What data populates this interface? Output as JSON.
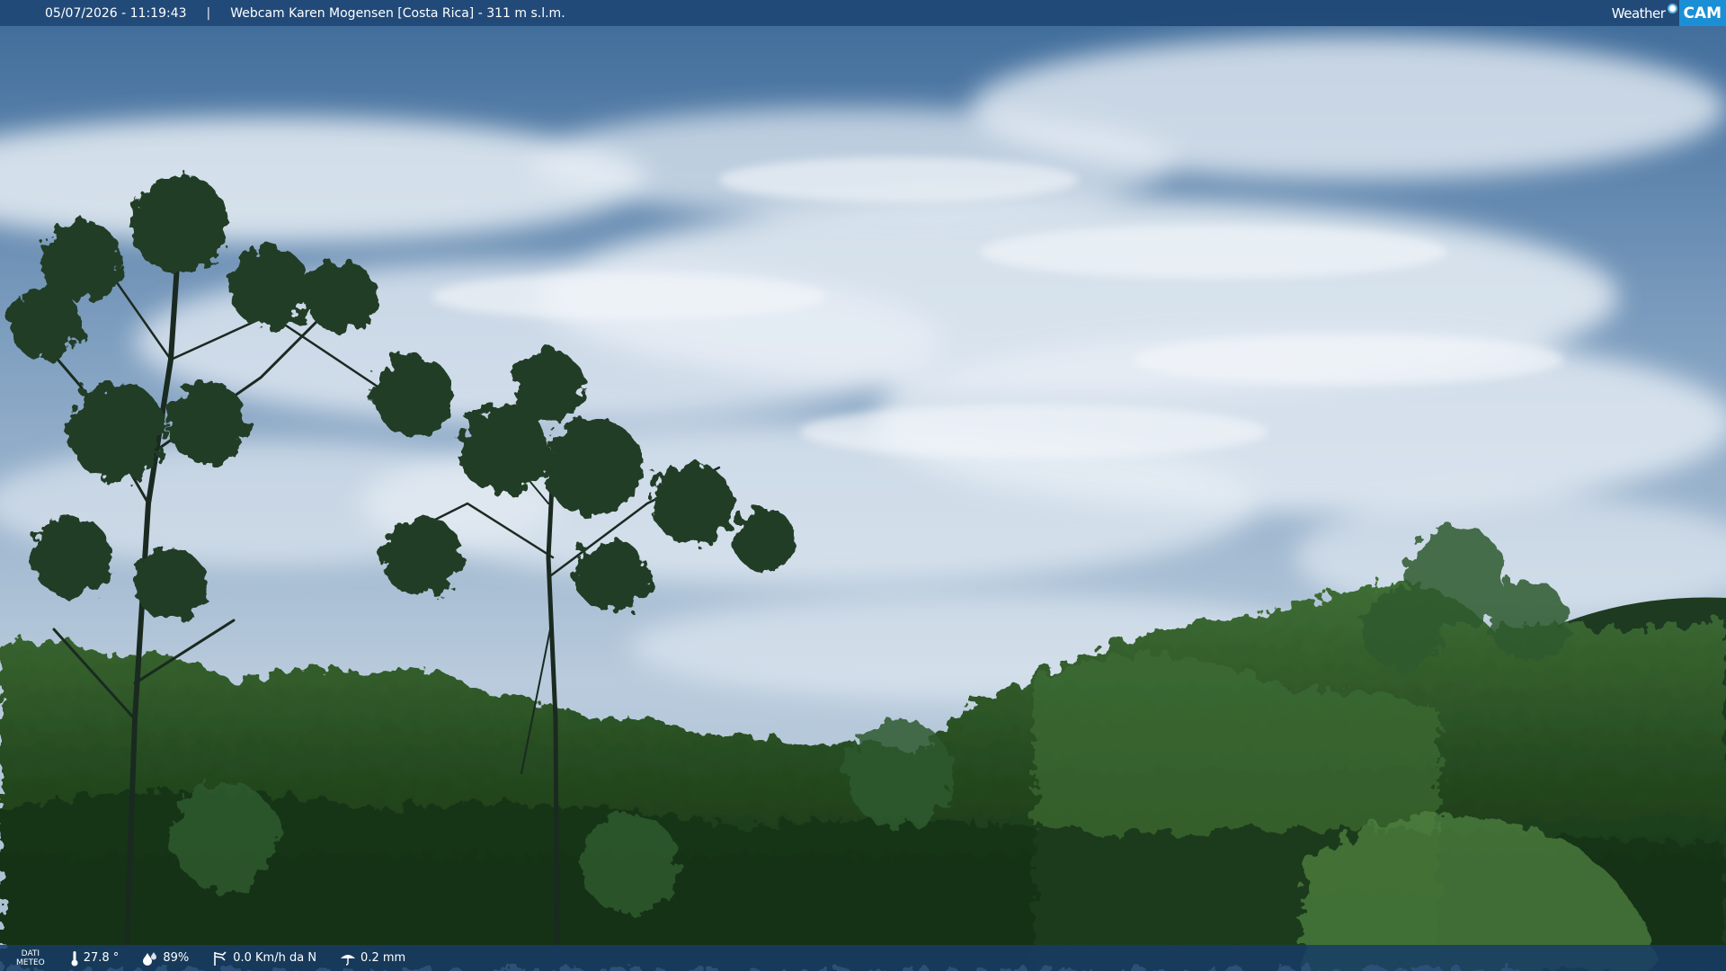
{
  "header": {
    "datetime": "05/07/2026 - 11:19:43",
    "separator": "|",
    "title": "Webcam Karen Mogensen [Costa Rica] - 311 m s.l.m."
  },
  "logo": {
    "word": "Weather",
    "cam": "CAM",
    "accent_color": "#1b8fd6"
  },
  "weather_bar": {
    "label_line1": "DATI",
    "label_line2": "METEO",
    "temperature": "27.8 °",
    "humidity": "89%",
    "wind": "0.0 Km/h da N",
    "rain": "0.2 mm",
    "icons": [
      "thermometer-icon",
      "humidity-drop-icon",
      "wind-icon",
      "rain-icon"
    ]
  },
  "scene": {
    "sky_top": "#3f6b9a",
    "sky_mid": "#9cb6cf",
    "cloud": "#e6edf4",
    "forest_dark": "#0f2a15",
    "forest_mid": "#2c5a2a",
    "forest_light": "#4a7a3a"
  }
}
